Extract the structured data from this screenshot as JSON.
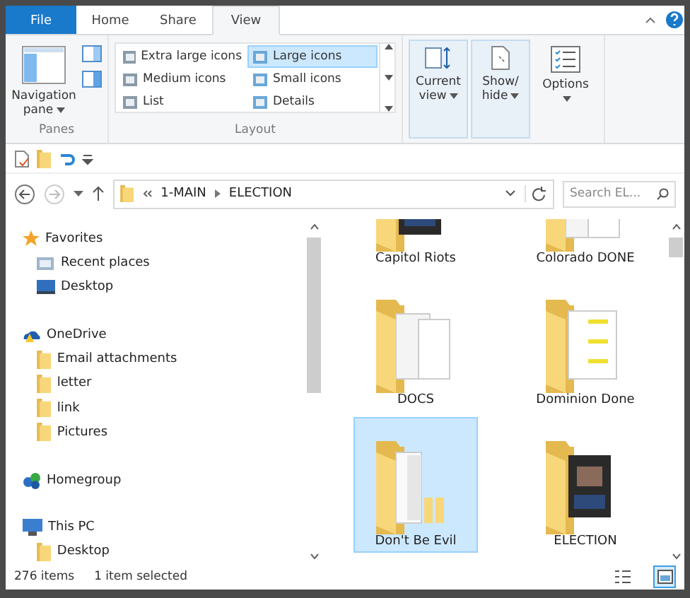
{
  "tabs": [
    {
      "label": "File",
      "kind": "file",
      "selected": false
    },
    {
      "label": "Home",
      "kind": "tab",
      "selected": false
    },
    {
      "label": "Share",
      "kind": "tab",
      "selected": false
    },
    {
      "label": "View",
      "kind": "tab",
      "selected": true
    }
  ],
  "ribbon": {
    "panes": {
      "label": "Panes",
      "navigation_pane": "Navigation pane"
    },
    "layout": {
      "label": "Layout",
      "options": [
        {
          "label": "Extra large icons",
          "selected": false
        },
        {
          "label": "Large icons",
          "selected": true
        },
        {
          "label": "Medium icons",
          "selected": false
        },
        {
          "label": "Small icons",
          "selected": false
        },
        {
          "label": "List",
          "selected": false
        },
        {
          "label": "Details",
          "selected": false
        }
      ]
    },
    "buttons": [
      {
        "label": "Current view",
        "kind": "current",
        "highlighted": true
      },
      {
        "label": "Show/ hide",
        "kind": "showhide",
        "highlighted": true
      },
      {
        "label": "Options",
        "kind": "options",
        "highlighted": false
      }
    ]
  },
  "address": {
    "path": [
      "1-MAIN",
      "ELECTION"
    ],
    "search_placeholder": "Search EL..."
  },
  "nav": [
    {
      "label": "Favorites",
      "kind": "star",
      "children": [
        {
          "label": "Recent places",
          "kind": "recent"
        },
        {
          "label": "Desktop",
          "kind": "desktop"
        }
      ]
    },
    {
      "label": "OneDrive",
      "kind": "cloud",
      "children": [
        {
          "label": "Email attachments",
          "kind": "folder"
        },
        {
          "label": "letter",
          "kind": "folder"
        },
        {
          "label": "link",
          "kind": "folder"
        },
        {
          "label": "Pictures",
          "kind": "folder"
        }
      ]
    },
    {
      "label": "Homegroup",
      "kind": "homegroup"
    },
    {
      "label": "This PC",
      "kind": "pc",
      "children": [
        {
          "label": "Desktop",
          "kind": "folder"
        }
      ]
    }
  ],
  "files": [
    {
      "name": "Capitol Riots",
      "kind": "photos",
      "selected": false
    },
    {
      "name": "Colorado DONE",
      "kind": "paper",
      "selected": false
    },
    {
      "name": "DOCS",
      "kind": "paper",
      "selected": false
    },
    {
      "name": "Dominion Done",
      "kind": "marked",
      "selected": false
    },
    {
      "name": "Don't Be Evil",
      "kind": "tabs",
      "selected": true
    },
    {
      "name": "ELECTION",
      "kind": "photos",
      "selected": false
    }
  ],
  "status": {
    "count": "276 items",
    "selection": "1 item selected"
  },
  "view_modes": [
    {
      "kind": "details",
      "selected": false
    },
    {
      "kind": "large",
      "selected": true
    }
  ]
}
